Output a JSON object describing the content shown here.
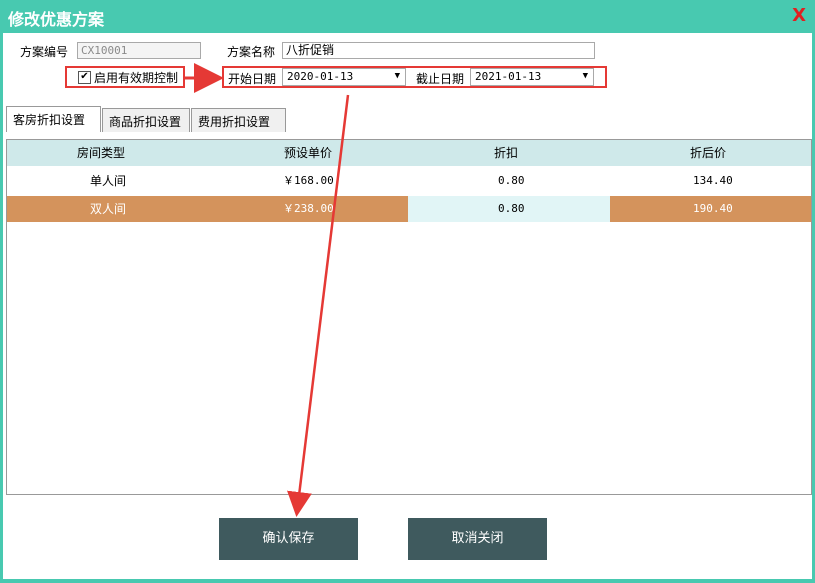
{
  "window": {
    "title": "修改优惠方案",
    "close_glyph": "X"
  },
  "form": {
    "code_label": "方案编号",
    "code_value": "CX10001",
    "name_label": "方案名称",
    "name_value": "八折促销",
    "enable_label": "启用有效期控制",
    "enable_checked": true,
    "start_label": "开始日期",
    "start_value": "2020-01-13",
    "end_label": "截止日期",
    "end_value": "2021-01-13"
  },
  "tabs": [
    {
      "label": "客房折扣设置",
      "active": true
    },
    {
      "label": "商品折扣设置",
      "active": false
    },
    {
      "label": "费用折扣设置",
      "active": false
    }
  ],
  "table": {
    "headers": [
      "房间类型",
      "预设单价",
      "折扣",
      "折后价"
    ],
    "rows": [
      [
        "单人间",
        "￥168.00",
        "0.80",
        "134.40"
      ],
      [
        "双人间",
        "￥238.00",
        "0.80",
        "190.40"
      ]
    ]
  },
  "buttons": {
    "save": "确认保存",
    "close": "取消关闭"
  },
  "colors": {
    "titlebar": "#48c9b0",
    "selected_row": "#d4935c",
    "header": "#cfe9ea",
    "button": "#3f5a5e",
    "annotation": "#e53935"
  }
}
